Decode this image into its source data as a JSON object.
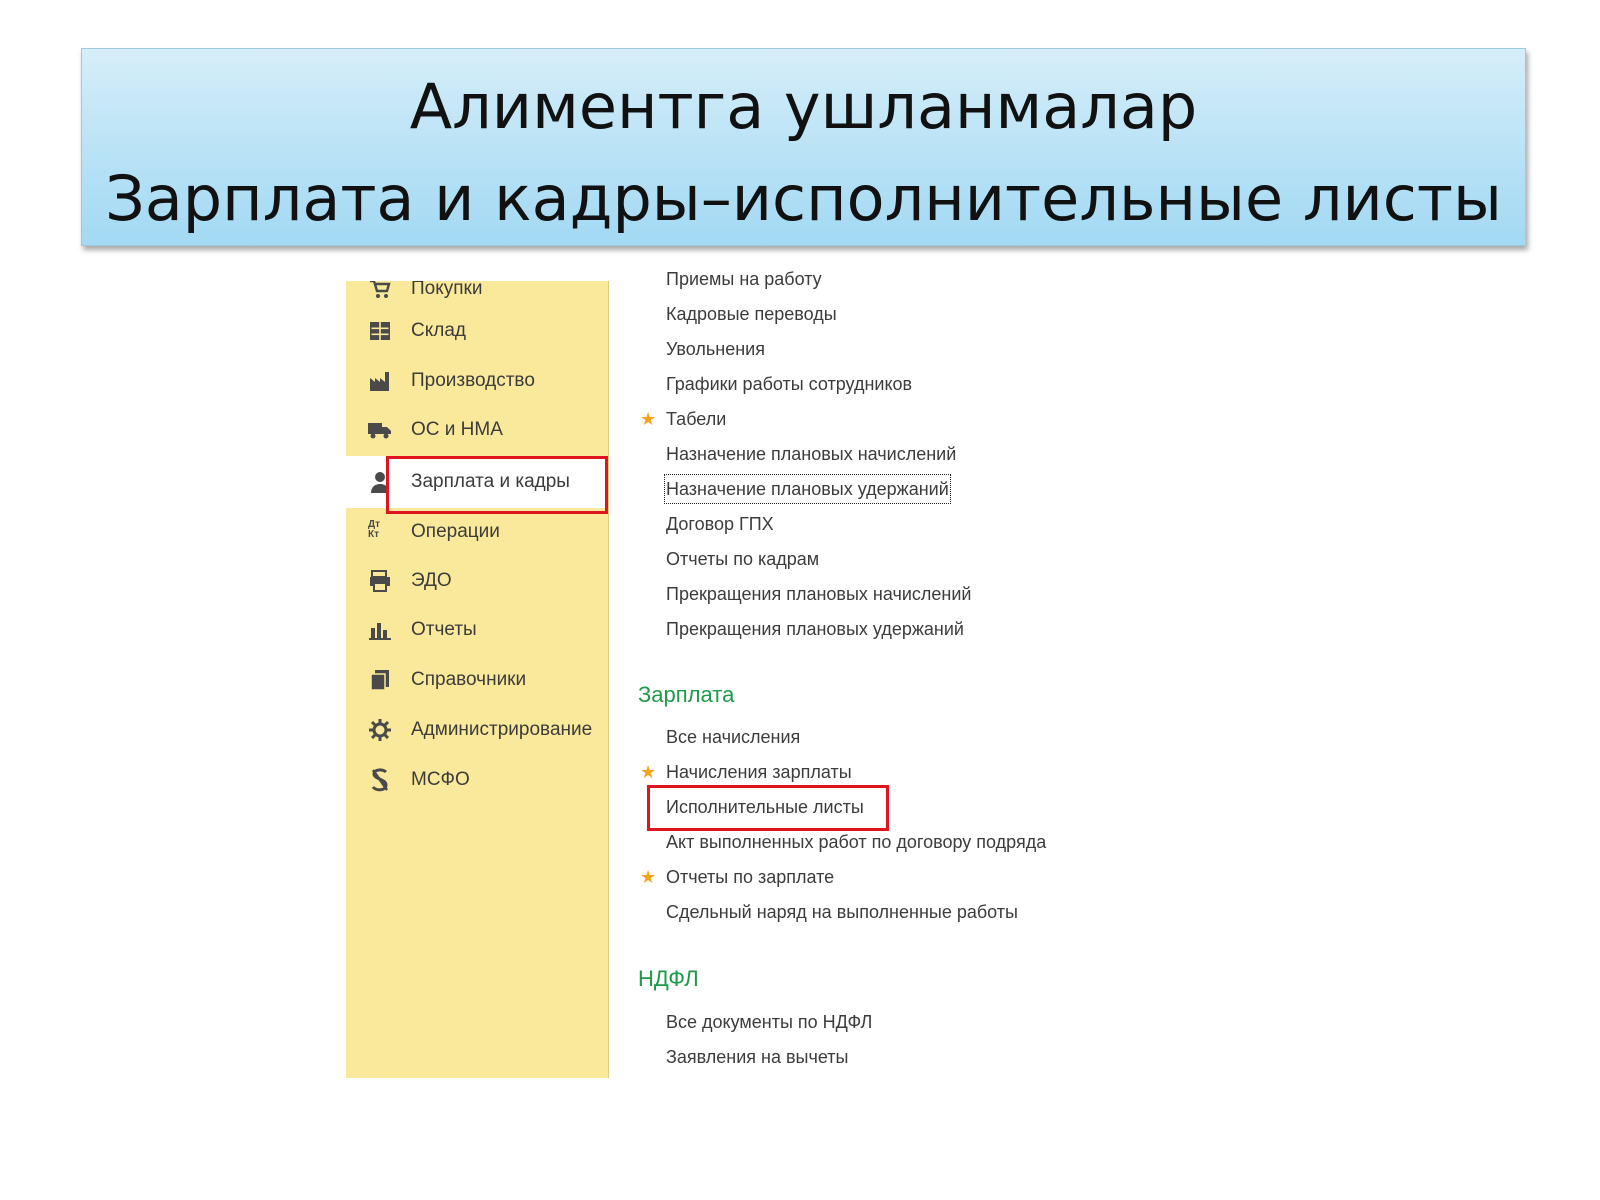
{
  "title": {
    "line1": "Алиментга ушланмалар",
    "line2": "Зарплата и кадры–исполнительные листы"
  },
  "sidebar": {
    "items": [
      {
        "label": "Покупки",
        "icon": "cart-icon"
      },
      {
        "label": "Склад",
        "icon": "warehouse-icon"
      },
      {
        "label": "Производство",
        "icon": "factory-icon"
      },
      {
        "label": "ОС и НМА",
        "icon": "truck-icon"
      },
      {
        "label": "Зарплата и кадры",
        "icon": "person-icon",
        "active": true
      },
      {
        "label": "Операции",
        "icon": "dt-kt-icon",
        "icon_text": "Дт Кт"
      },
      {
        "label": "ЭДО",
        "icon": "edo-icon"
      },
      {
        "label": "Отчеты",
        "icon": "bar-chart-icon"
      },
      {
        "label": "Справочники",
        "icon": "books-icon"
      },
      {
        "label": "Администрирование",
        "icon": "gear-icon"
      },
      {
        "label": "МСФО",
        "icon": "msfo-icon"
      }
    ]
  },
  "content": {
    "hr_items": [
      {
        "label": "Приемы на работу"
      },
      {
        "label": "Кадровые переводы"
      },
      {
        "label": "Увольнения"
      },
      {
        "label": "Графики работы сотрудников"
      },
      {
        "label": "Табели",
        "starred": true
      },
      {
        "label": "Назначение плановых начислений"
      },
      {
        "label": "Назначение плановых удержаний",
        "focused": true
      },
      {
        "label": "Договор ГПХ"
      },
      {
        "label": "Отчеты по кадрам"
      },
      {
        "label": "Прекращения плановых начислений"
      },
      {
        "label": "Прекращения плановых удержаний"
      }
    ],
    "salary_section": "Зарплата",
    "salary_items": [
      {
        "label": "Все начисления"
      },
      {
        "label": "Начисления зарплаты",
        "starred": true
      },
      {
        "label": "Исполнительные листы",
        "highlighted": true
      },
      {
        "label": "Акт выполненных работ по договору подряда"
      },
      {
        "label": "Отчеты по зарплате",
        "starred": true
      },
      {
        "label": "Сдельный наряд на выполненные работы"
      }
    ],
    "ndfl_section": "НДФЛ",
    "ndfl_items": [
      {
        "label": "Все документы по НДФЛ"
      },
      {
        "label": "Заявления на вычеты"
      }
    ]
  },
  "colors": {
    "sidebar_bg": "#fae99a",
    "section_heading": "#1e9a4a",
    "highlight_box": "#e0141e",
    "star": "#f2a41a"
  }
}
